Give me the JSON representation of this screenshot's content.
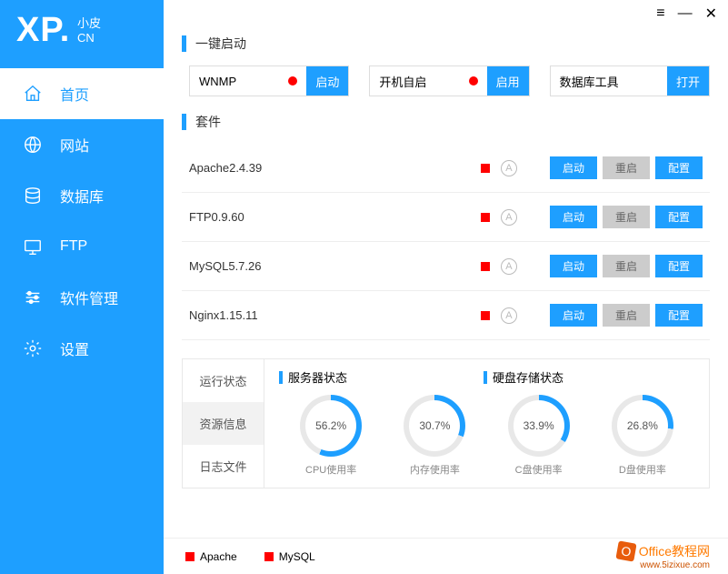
{
  "logo": {
    "main": "XP.",
    "sub1": "小皮",
    "sub2": "CN"
  },
  "nav": [
    {
      "label": "首页"
    },
    {
      "label": "网站"
    },
    {
      "label": "数据库"
    },
    {
      "label": "FTP"
    },
    {
      "label": "软件管理"
    },
    {
      "label": "设置"
    }
  ],
  "section1": {
    "title": "一键启动"
  },
  "quick": [
    {
      "label": "WNMP",
      "btn": "启动"
    },
    {
      "label": "开机自启",
      "btn": "启用"
    },
    {
      "label": "数据库工具",
      "btn": "打开"
    }
  ],
  "section2": {
    "title": "套件"
  },
  "suites": [
    {
      "name": "Apache2.4.39",
      "badge": "A",
      "b1": "启动",
      "b2": "重启",
      "b3": "配置"
    },
    {
      "name": "FTP0.9.60",
      "badge": "A",
      "b1": "启动",
      "b2": "重启",
      "b3": "配置"
    },
    {
      "name": "MySQL5.7.26",
      "badge": "A",
      "b1": "启动",
      "b2": "重启",
      "b3": "配置"
    },
    {
      "name": "Nginx1.15.11",
      "badge": "A",
      "b1": "启动",
      "b2": "重启",
      "b3": "配置"
    }
  ],
  "status": {
    "tabs": [
      "运行状态",
      "资源信息",
      "日志文件"
    ],
    "hdr1": "服务器状态",
    "hdr2": "硬盘存储状态",
    "gauges": [
      {
        "pct": "56.2%",
        "label": "CPU使用率",
        "deg": 202
      },
      {
        "pct": "30.7%",
        "label": "内存使用率",
        "deg": 111
      },
      {
        "pct": "33.9%",
        "label": "C盘使用率",
        "deg": 122
      },
      {
        "pct": "26.8%",
        "label": "D盘使用率",
        "deg": 96
      }
    ]
  },
  "legend": [
    {
      "label": "Apache"
    },
    {
      "label": "MySQL"
    }
  ],
  "watermark": {
    "brand": "Office教程网",
    "sub": "www.5izixue.com"
  }
}
